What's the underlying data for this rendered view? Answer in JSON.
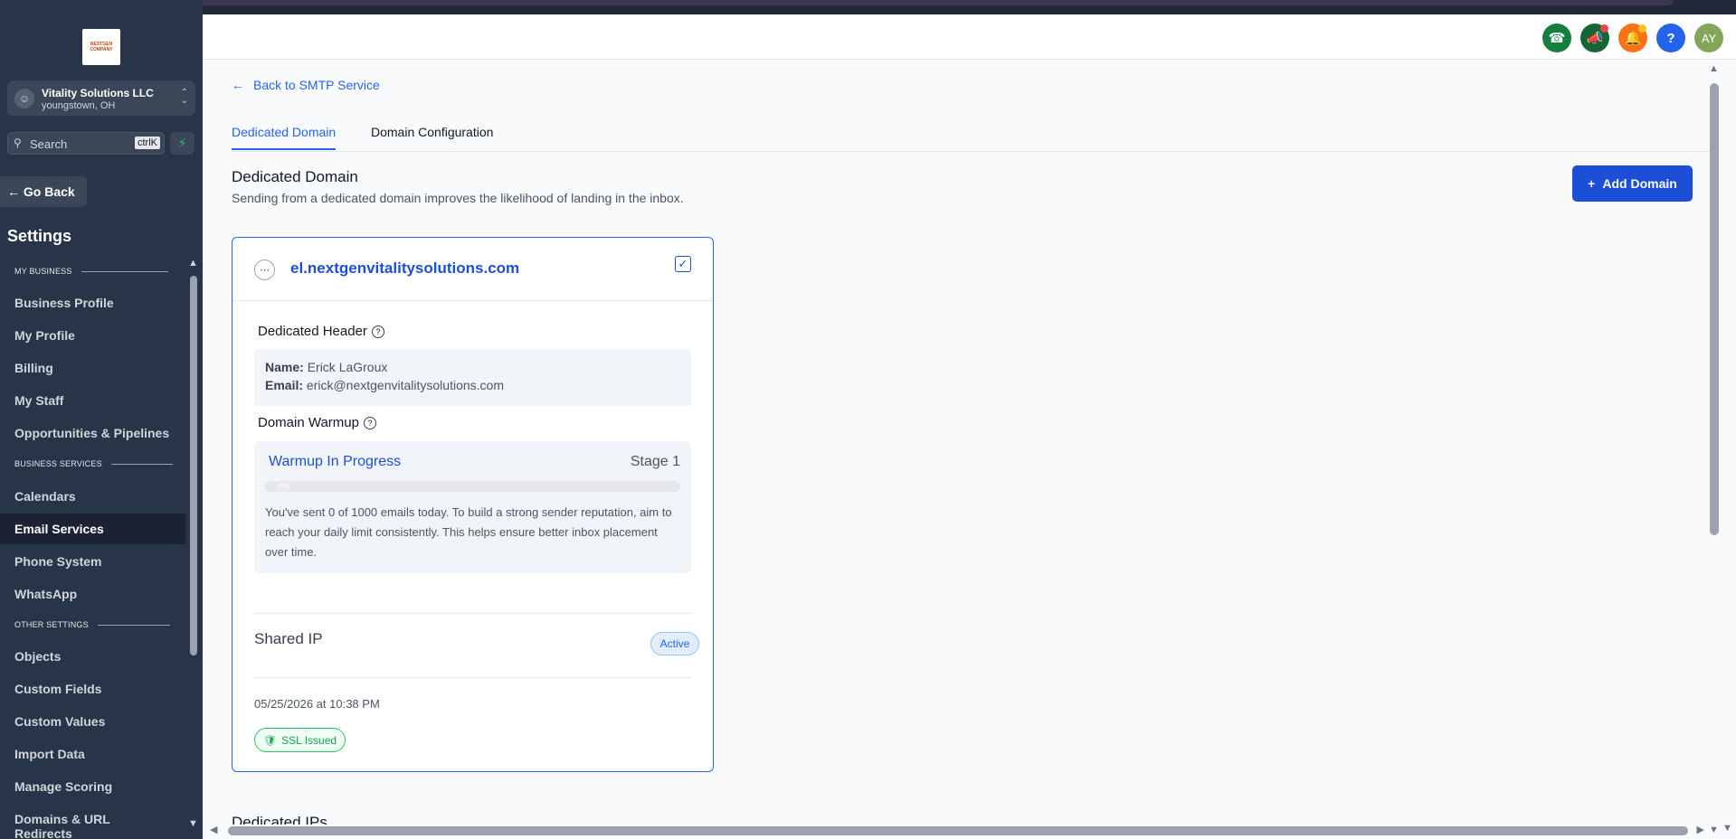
{
  "account": {
    "name": "Vitality Solutions LLC",
    "location": "youngstown, OH"
  },
  "logo": {
    "text": "NEXTGEN COMPANY"
  },
  "search": {
    "placeholder": "Search",
    "shortcut": "ctrlK"
  },
  "sidebar": {
    "go_back": "Go Back",
    "title": "Settings",
    "sections": [
      {
        "label": "MY BUSINESS",
        "items": [
          "Business Profile",
          "My Profile",
          "Billing",
          "My Staff",
          "Opportunities & Pipelines"
        ]
      },
      {
        "label": "BUSINESS SERVICES",
        "items": [
          "Calendars",
          "Email Services",
          "Phone System",
          "WhatsApp"
        ]
      },
      {
        "label": "OTHER SETTINGS",
        "items": [
          "Objects",
          "Custom Fields",
          "Custom Values",
          "Import Data",
          "Manage Scoring",
          "Domains & URL Redirects"
        ]
      }
    ],
    "active_item": "Email Services"
  },
  "header": {
    "user_initials": "AY",
    "help_label": "?"
  },
  "colors": {
    "accent": "#2563eb",
    "phone": "#15803d",
    "announce": "#166534",
    "bell": "#f97316",
    "help": "#2563eb",
    "avatar": "#84a65a",
    "success": "#16a34a"
  },
  "main": {
    "back_link": "Back to SMTP Service",
    "tabs": [
      "Dedicated Domain",
      "Domain Configuration"
    ],
    "title": "Dedicated Domain",
    "subtitle": "Sending from a dedicated domain improves the likelihood of landing in the inbox.",
    "add_button": "Add Domain",
    "next_section": "Dedicated IPs"
  },
  "card": {
    "domain": "el.nextgenvitalitysolutions.com",
    "header_label": "Dedicated Header",
    "name_label": "Name:",
    "name_value": "Erick LaGroux",
    "email_label": "Email:",
    "email_value": "erick@nextgenvitalitysolutions.com",
    "warmup_label": "Domain Warmup",
    "warmup_status": "Warmup In Progress",
    "stage": "Stage 1",
    "progress_text": "0%",
    "progress": 0,
    "warmup_text": "You've sent 0 of 1000 emails today. To build a strong sender reputation, aim to reach your daily limit consistently. This helps ensure better inbox placement over time.",
    "ip_label": "Shared IP",
    "ip_status": "Active",
    "date": "05/25/2026 at 10:38 PM",
    "ssl": "SSL Issued"
  }
}
